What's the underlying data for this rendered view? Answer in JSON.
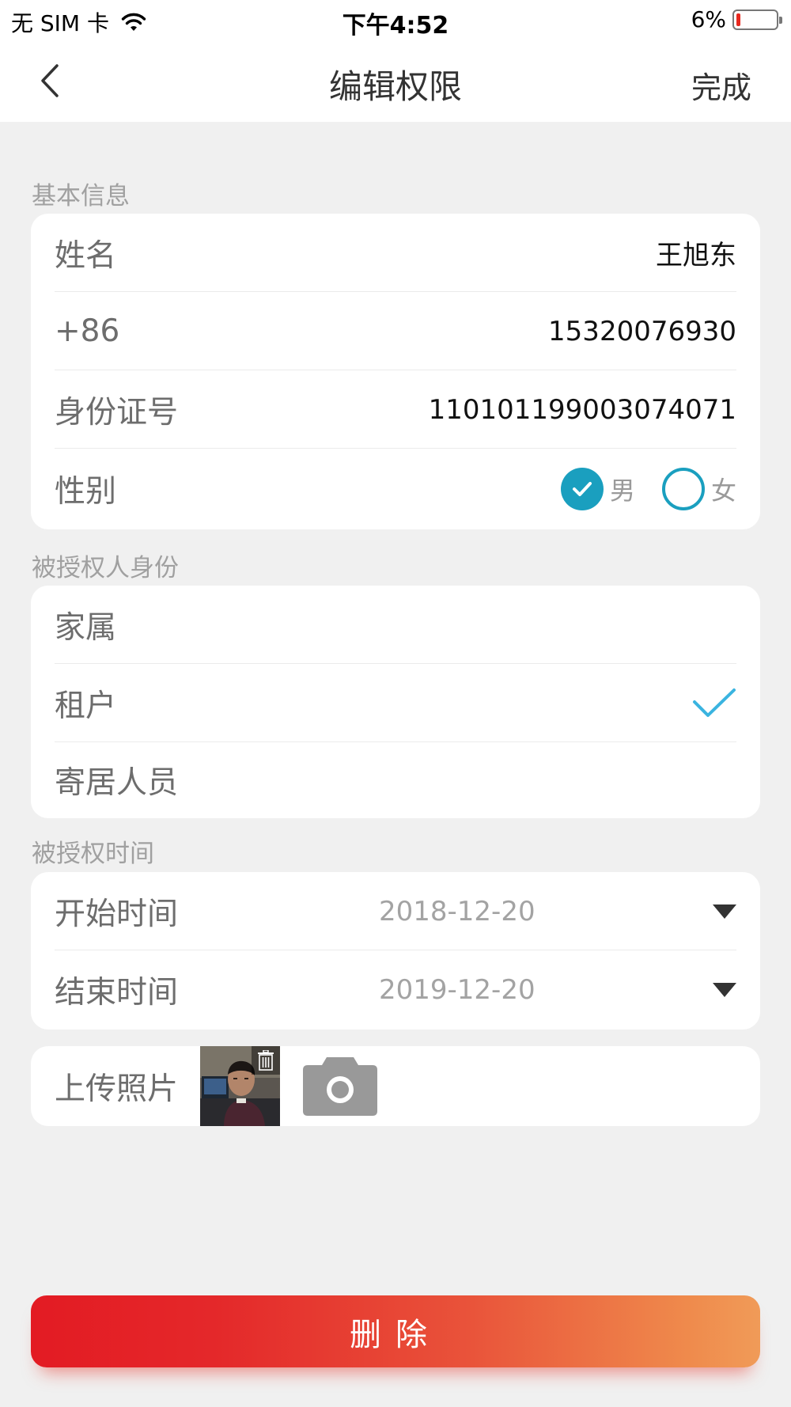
{
  "status_bar": {
    "carrier": "无 SIM 卡",
    "time": "下午4:52",
    "battery": "6%"
  },
  "nav": {
    "title": "编辑权限",
    "done_label": "完成"
  },
  "basic_info": {
    "section_label": "基本信息",
    "name_label": "姓名",
    "name_value": "王旭东",
    "phone_prefix": "+86",
    "phone_value": "15320076930",
    "id_label": "身份证号",
    "id_value": "110101199003074071",
    "gender_label": "性别",
    "gender_options": [
      "男",
      "女"
    ],
    "gender_selected": "男"
  },
  "identity": {
    "section_label": "被授权人身份",
    "options": [
      "家属",
      "租户",
      "寄居人员"
    ],
    "selected": "租户"
  },
  "time": {
    "section_label": "被授权时间",
    "start_label": "开始时间",
    "start_value": "2018-12-20",
    "end_label": "结束时间",
    "end_value": "2019-12-20"
  },
  "upload": {
    "label": "上传照片"
  },
  "delete_label": "删除",
  "colors": {
    "accent": "#1a9fbf",
    "checkmark": "#3ab4e0",
    "delete_start": "#e31b23",
    "delete_end": "#f09b58",
    "background": "#f0f0f0"
  },
  "icons": [
    "wifi-icon",
    "battery-icon",
    "back-chevron-icon",
    "checkmark-icon",
    "dropdown-arrow-icon",
    "trash-icon",
    "camera-icon"
  ]
}
